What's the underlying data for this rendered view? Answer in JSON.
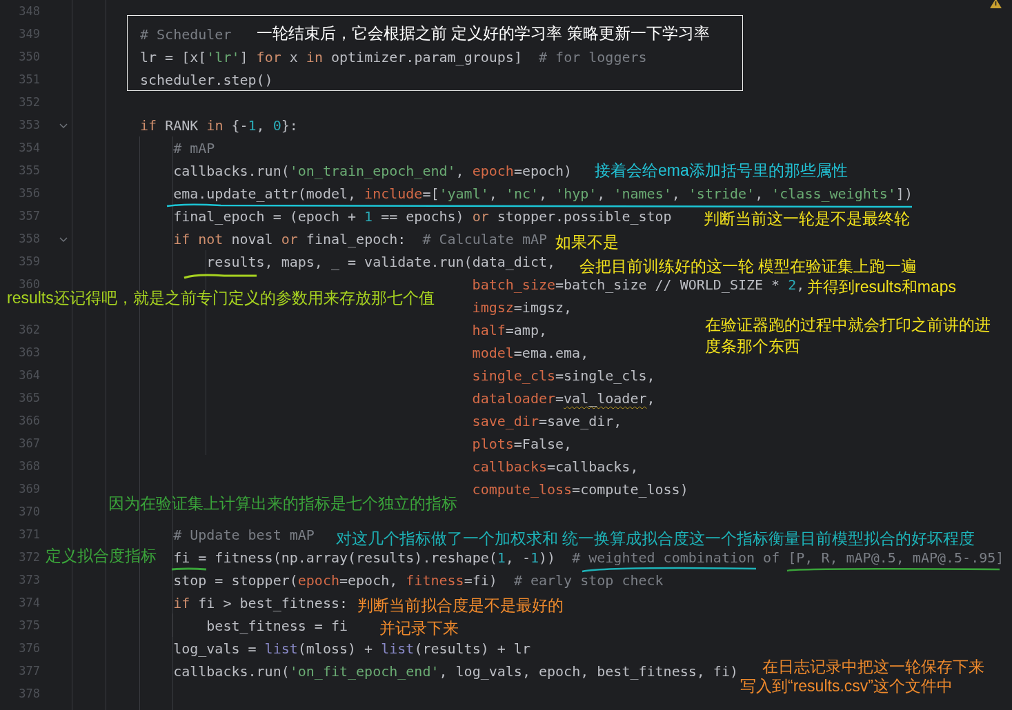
{
  "editor": {
    "lines": [
      {
        "number": "348"
      },
      {
        "number": "349",
        "tokens": [
          {
            "kind": "comment",
            "text": "# Scheduler"
          }
        ]
      },
      {
        "number": "350",
        "tokens": [
          {
            "kind": "plain",
            "text": "lr = [x["
          },
          {
            "kind": "string",
            "text": "'lr'"
          },
          {
            "kind": "plain",
            "text": "] "
          },
          {
            "kind": "keyword",
            "text": "for"
          },
          {
            "kind": "plain",
            "text": " x "
          },
          {
            "kind": "keyword",
            "text": "in"
          },
          {
            "kind": "plain",
            "text": " optimizer.param_groups]  "
          },
          {
            "kind": "comment",
            "text": "# for loggers"
          }
        ]
      },
      {
        "number": "351",
        "tokens": [
          {
            "kind": "plain",
            "text": "scheduler.step()"
          }
        ]
      },
      {
        "number": "352"
      },
      {
        "number": "353",
        "expanded": true,
        "tokens": [
          {
            "kind": "keyword",
            "text": "if"
          },
          {
            "kind": "plain",
            "text": " RANK "
          },
          {
            "kind": "keyword",
            "text": "in"
          },
          {
            "kind": "plain",
            "text": " {-"
          },
          {
            "kind": "number",
            "text": "1"
          },
          {
            "kind": "plain",
            "text": ", "
          },
          {
            "kind": "number",
            "text": "0"
          },
          {
            "kind": "plain",
            "text": "}:"
          }
        ],
        "children": [
          {
            "number": "354",
            "tokens": [
              {
                "kind": "comment",
                "text": "# mAP"
              }
            ]
          },
          {
            "number": "355",
            "tokens": [
              {
                "kind": "plain",
                "text": "callbacks.run("
              },
              {
                "kind": "string",
                "text": "'on_train_epoch_end'"
              },
              {
                "kind": "plain",
                "text": ", "
              },
              {
                "kind": "param",
                "text": "epoch"
              },
              {
                "kind": "plain",
                "text": "=epoch)"
              }
            ]
          },
          {
            "number": "356",
            "tokens": [
              {
                "kind": "plain",
                "text": "ema.update_attr(model, "
              },
              {
                "kind": "param",
                "text": "include"
              },
              {
                "kind": "plain",
                "text": "=["
              },
              {
                "kind": "string",
                "text": "'yaml'"
              },
              {
                "kind": "plain",
                "text": ", "
              },
              {
                "kind": "string",
                "text": "'nc'"
              },
              {
                "kind": "plain",
                "text": ", "
              },
              {
                "kind": "string",
                "text": "'hyp'"
              },
              {
                "kind": "plain",
                "text": ", "
              },
              {
                "kind": "string",
                "text": "'names'"
              },
              {
                "kind": "plain",
                "text": ", "
              },
              {
                "kind": "string",
                "text": "'stride'"
              },
              {
                "kind": "plain",
                "text": ", "
              },
              {
                "kind": "string",
                "text": "'class_weights'"
              },
              {
                "kind": "plain",
                "text": "])"
              }
            ]
          },
          {
            "number": "357",
            "tokens": [
              {
                "kind": "plain",
                "text": "final_epoch = (epoch + "
              },
              {
                "kind": "number",
                "text": "1"
              },
              {
                "kind": "plain",
                "text": " == epochs) "
              },
              {
                "kind": "keyword",
                "text": "or"
              },
              {
                "kind": "plain",
                "text": " stopper.possible_stop"
              }
            ]
          },
          {
            "number": "358",
            "expanded": true,
            "tokens": [
              {
                "kind": "keyword",
                "text": "if not"
              },
              {
                "kind": "plain",
                "text": " noval "
              },
              {
                "kind": "keyword",
                "text": "or"
              },
              {
                "kind": "plain",
                "text": " final_epoch:  "
              },
              {
                "kind": "comment",
                "text": "# Calculate mAP"
              }
            ],
            "children": [
              {
                "number": "359",
                "tokens": [
                  {
                    "kind": "plain",
                    "text": "results, maps, _ = validate.run(data_dict,"
                  }
                ],
                "continuation": [
                  {
                    "number": "360",
                    "tokens": [
                      {
                        "kind": "param",
                        "text": "batch_size"
                      },
                      {
                        "kind": "plain",
                        "text": "=batch_size // WORLD_SIZE * "
                      },
                      {
                        "kind": "number",
                        "text": "2"
                      },
                      {
                        "kind": "plain",
                        "text": ","
                      }
                    ]
                  },
                  {
                    "tokens": [
                      {
                        "kind": "param",
                        "text": "imgsz"
                      },
                      {
                        "kind": "plain",
                        "text": "=imgsz,"
                      }
                    ]
                  },
                  {
                    "number": "362",
                    "tokens": [
                      {
                        "kind": "param",
                        "text": "half"
                      },
                      {
                        "kind": "plain",
                        "text": "=amp,"
                      }
                    ]
                  },
                  {
                    "number": "363",
                    "tokens": [
                      {
                        "kind": "param",
                        "text": "model"
                      },
                      {
                        "kind": "plain",
                        "text": "=ema.ema,"
                      }
                    ]
                  },
                  {
                    "number": "364",
                    "tokens": [
                      {
                        "kind": "param",
                        "text": "single_cls"
                      },
                      {
                        "kind": "plain",
                        "text": "=single_cls,"
                      }
                    ]
                  },
                  {
                    "number": "365",
                    "tokens": [
                      {
                        "kind": "param",
                        "text": "dataloader"
                      },
                      {
                        "kind": "plain",
                        "text": "="
                      },
                      {
                        "kind": "warning",
                        "text": "val_loader"
                      },
                      {
                        "kind": "plain",
                        "text": ","
                      }
                    ]
                  },
                  {
                    "number": "366",
                    "tokens": [
                      {
                        "kind": "param",
                        "text": "save_dir"
                      },
                      {
                        "kind": "plain",
                        "text": "=save_dir,"
                      }
                    ]
                  },
                  {
                    "number": "367",
                    "tokens": [
                      {
                        "kind": "param",
                        "text": "plots"
                      },
                      {
                        "kind": "plain",
                        "text": "=False,"
                      }
                    ]
                  },
                  {
                    "number": "368",
                    "tokens": [
                      {
                        "kind": "param",
                        "text": "callbacks"
                      },
                      {
                        "kind": "plain",
                        "text": "=callbacks,"
                      }
                    ]
                  },
                  {
                    "number": "369",
                    "tokens": [
                      {
                        "kind": "param",
                        "text": "compute_loss"
                      },
                      {
                        "kind": "plain",
                        "text": "=compute_loss)"
                      }
                    ]
                  }
                ]
              }
            ]
          },
          {
            "number": "370"
          },
          {
            "number": "371",
            "tokens": [
              {
                "kind": "comment",
                "text": "# Update best mAP"
              }
            ]
          },
          {
            "number": "372",
            "tokens": [
              {
                "kind": "plain",
                "text": "fi = fitness(np.array(results).reshape("
              },
              {
                "kind": "number",
                "text": "1"
              },
              {
                "kind": "plain",
                "text": ", -"
              },
              {
                "kind": "number",
                "text": "1"
              },
              {
                "kind": "plain",
                "text": "))  "
              },
              {
                "kind": "comment",
                "text": "# weighted combination of [P, R, mAP@.5, mAP@.5-.95]"
              }
            ]
          },
          {
            "number": "373",
            "tokens": [
              {
                "kind": "plain",
                "text": "stop = stopper("
              },
              {
                "kind": "param",
                "text": "epoch"
              },
              {
                "kind": "plain",
                "text": "=epoch, "
              },
              {
                "kind": "param",
                "text": "fitness"
              },
              {
                "kind": "plain",
                "text": "=fi)  "
              },
              {
                "kind": "comment",
                "text": "# early stop check"
              }
            ]
          },
          {
            "number": "374",
            "tokens": [
              {
                "kind": "keyword",
                "text": "if"
              },
              {
                "kind": "plain",
                "text": " fi > best_fitness:"
              }
            ],
            "children": [
              {
                "number": "375",
                "tokens": [
                  {
                    "kind": "plain",
                    "text": "best_fitness = fi"
                  }
                ]
              }
            ]
          },
          {
            "number": "376",
            "tokens": [
              {
                "kind": "plain",
                "text": "log_vals = "
              },
              {
                "kind": "builtin",
                "text": "list"
              },
              {
                "kind": "plain",
                "text": "(mloss) + "
              },
              {
                "kind": "builtin",
                "text": "list"
              },
              {
                "kind": "plain",
                "text": "(results) + lr"
              }
            ]
          },
          {
            "number": "377",
            "tokens": [
              {
                "kind": "plain",
                "text": "callbacks.run("
              },
              {
                "kind": "string",
                "text": "'on_fit_epoch_end'"
              },
              {
                "kind": "plain",
                "text": ", log_vals, epoch, best_fitness, fi)"
              }
            ]
          },
          {
            "number": "378"
          }
        ]
      }
    ]
  },
  "annotations": [
    {
      "text": "一轮结束后，它会根据之前  定义好的学习率 策略更新一下学习率",
      "color": "#ffffff"
    },
    {
      "text": "接着会给ema添加括号里的那些属性",
      "color": "#22c3d6"
    },
    {
      "text": "判断当前这一轮是不是最终轮",
      "color": "#f2e21c"
    },
    {
      "text": "如果不是",
      "color": "#f2e21c"
    },
    {
      "text": "会把目前训练好的这一轮 模型在验证集上跑一遍",
      "color": "#f2e21c"
    },
    {
      "text": "并得到results和maps",
      "color": "#f2e21c"
    },
    {
      "text": "results还记得吧，就是之前专门定义的参数用来存放那七个值",
      "color": "#a8d420"
    },
    {
      "text": "在验证器跑的过程中就会打印之前讲的进度条那个东西",
      "color": "#f2e21c"
    },
    {
      "text": "因为在验证集上计算出来的指标是七个独立的指标",
      "color": "#3aa43a"
    },
    {
      "text": "对这几个指标做了一个加权求和 统一换算成拟合度这一个指标衡量目前模型拟合的好坏程度",
      "color": "#1db3b8"
    },
    {
      "text": "定义拟合度指标",
      "color": "#3aa43a"
    },
    {
      "text": "判断当前拟合度是不是最好的",
      "color": "#f08a2c"
    },
    {
      "text": "并记录下来",
      "color": "#f08a2c"
    },
    {
      "text": "在日志记录中把这一轮保存下来",
      "color": "#f08a2c"
    },
    {
      "text": "写入到“results.csv”这个文件中",
      "color": "#f08a2c"
    }
  ]
}
